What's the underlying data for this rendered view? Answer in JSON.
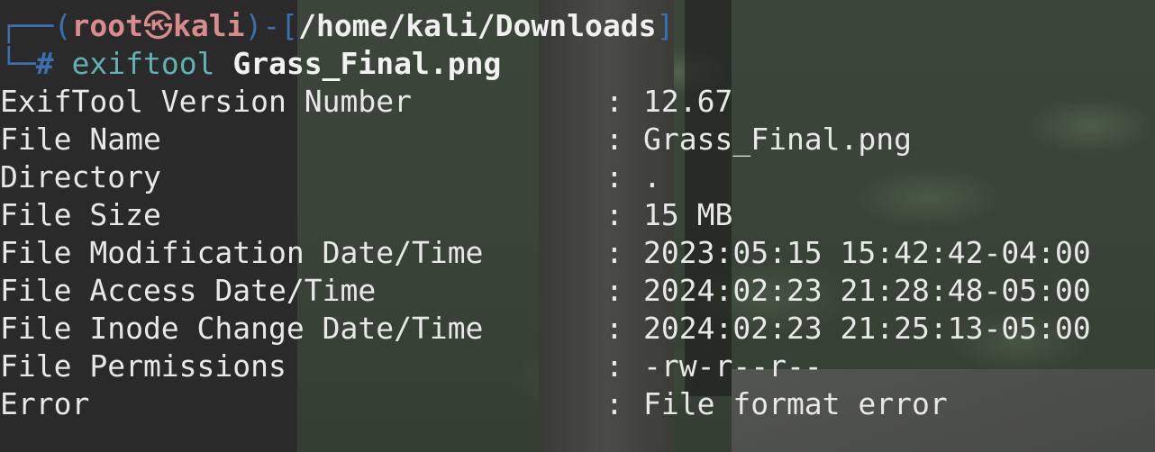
{
  "prompt": {
    "corner_top": "┌──",
    "open_paren": "(",
    "user": "root",
    "host_icon": "㉿",
    "host": "kali",
    "close_paren": ")",
    "dash_bracket": "-[",
    "path": "/home/kali/Downloads",
    "close_bracket": "]",
    "corner_bottom": "└─",
    "hash": "#",
    "command": "exiftool",
    "argument": "Grass_Final.png"
  },
  "output": {
    "separator": ": ",
    "rows": [
      {
        "key": "ExifTool Version Number",
        "value": "12.67"
      },
      {
        "key": "File Name",
        "value": "Grass_Final.png"
      },
      {
        "key": "Directory",
        "value": "."
      },
      {
        "key": "File Size",
        "value": "15 MB"
      },
      {
        "key": "File Modification Date/Time",
        "value": "2023:05:15 15:42:42-04:00"
      },
      {
        "key": "File Access Date/Time",
        "value": "2024:02:23 21:28:48-05:00"
      },
      {
        "key": "File Inode Change Date/Time",
        "value": "2024:02:23 21:25:13-05:00"
      },
      {
        "key": "File Permissions",
        "value": "-rw-r--r--"
      },
      {
        "key": "Error",
        "value": "File format error"
      }
    ]
  }
}
